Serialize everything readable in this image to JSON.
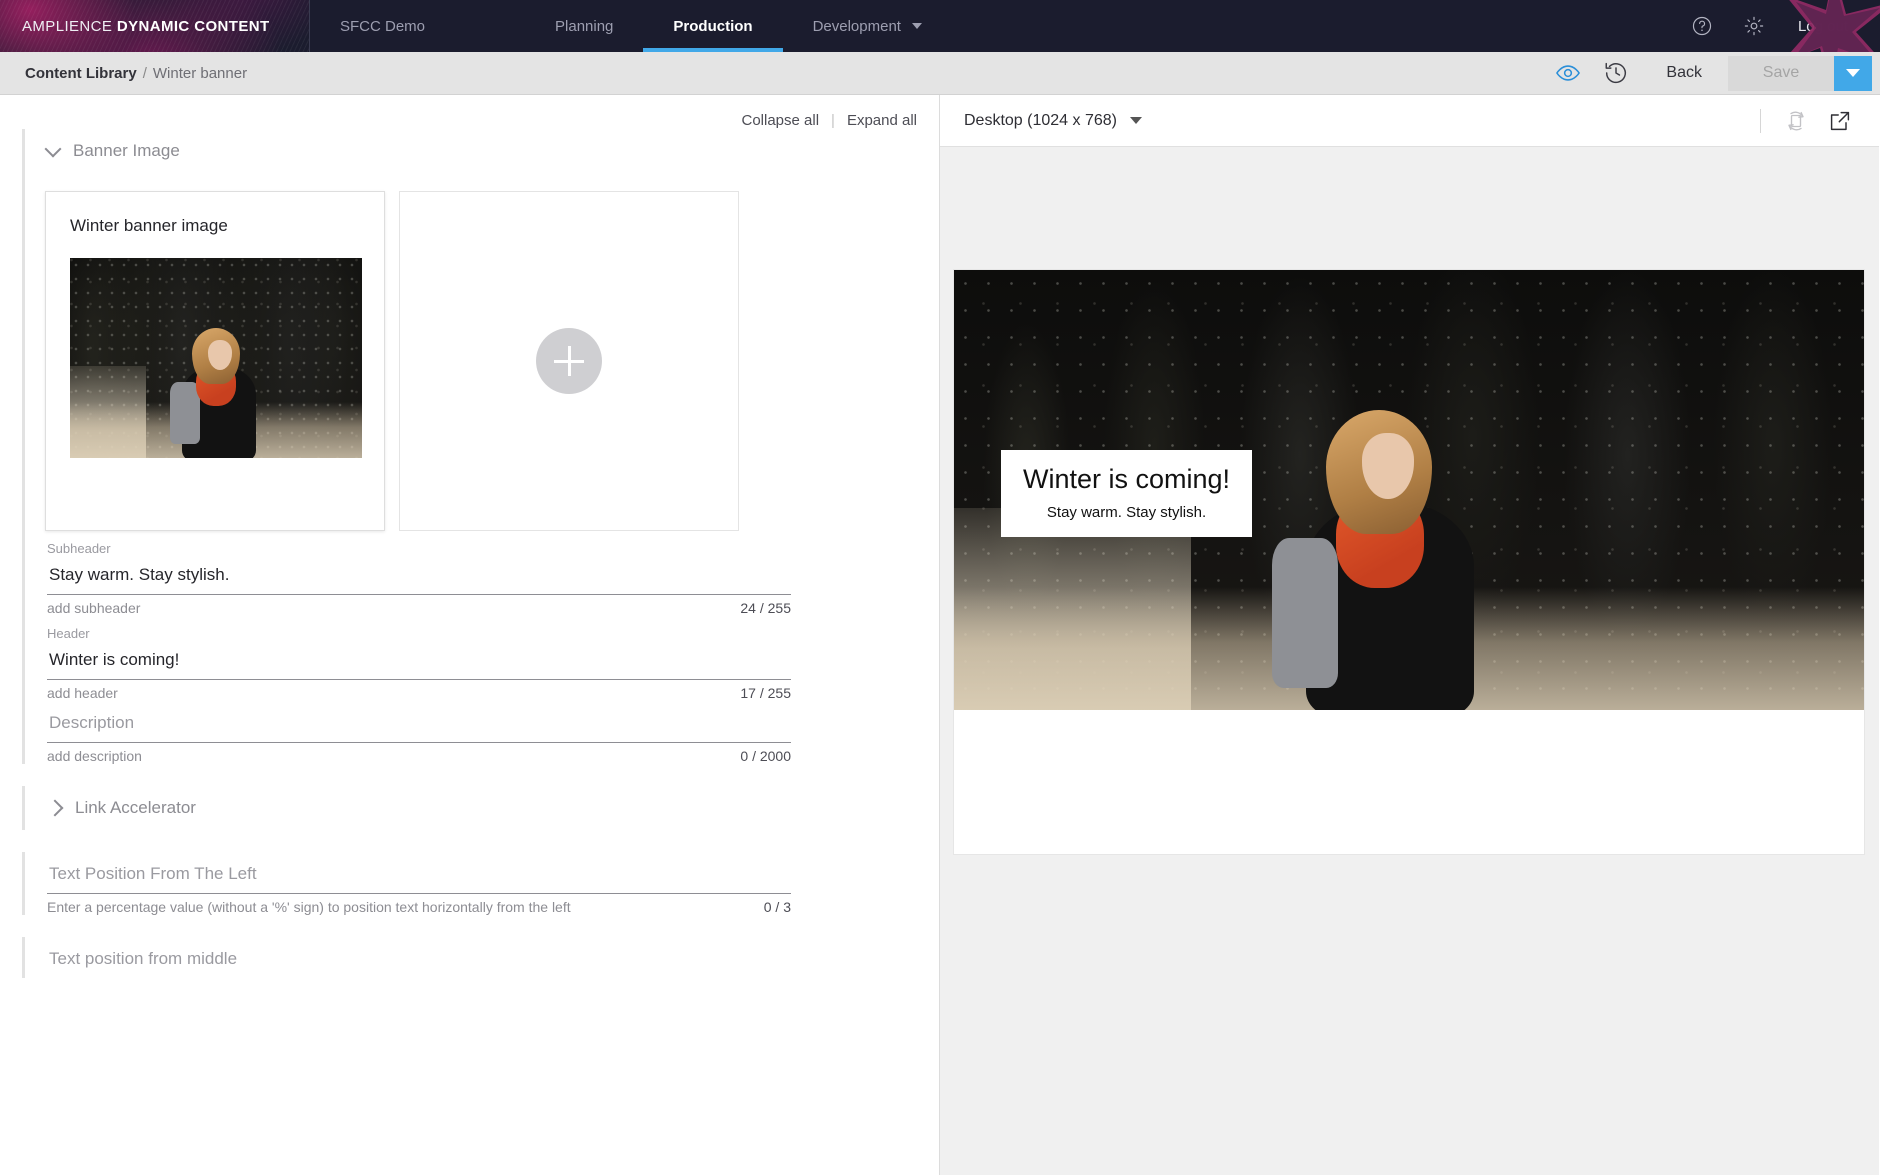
{
  "topnav": {
    "brand_light": "AMPLIENCE ",
    "brand_bold": "DYNAMIC CONTENT",
    "tenant": "SFCC Demo",
    "items": [
      {
        "label": "Planning",
        "active": false
      },
      {
        "label": "Production",
        "active": true
      },
      {
        "label": "Development",
        "active": false
      }
    ],
    "help_icon": "help-circle-icon",
    "settings_icon": "gear-icon",
    "logout": "Log out",
    "accent_active": "#41a8e8",
    "bar_bg": "#1b1c2e"
  },
  "subbar": {
    "breadcrumb_root": "Content Library",
    "breadcrumb_sep": "/",
    "breadcrumb_current": "Winter banner",
    "preview_icon": "eye-icon",
    "history_icon": "history-clock-icon",
    "back_label": "Back",
    "save_label": "Save",
    "save_dropdown_icon": "chevron-down-icon",
    "save_accent": "#41a8e8"
  },
  "editor": {
    "collapse_all": "Collapse all",
    "divider": "|",
    "expand_all": "Expand all",
    "sections": [
      {
        "title": "Banner Image",
        "expanded": true
      },
      {
        "title": "Link Accelerator",
        "expanded": false
      }
    ],
    "media_card": {
      "title": "Winter banner image",
      "image_alt": "winter-banner-thumbnail"
    },
    "add_card": {
      "icon": "plus-icon"
    },
    "fields": [
      {
        "label": "Subheader",
        "value": "Stay warm. Stay stylish.",
        "hint": "add subheader",
        "counter": "24 / 255",
        "empty": false
      },
      {
        "label": "Header",
        "value": "Winter is coming!",
        "hint": "add header",
        "counter": "17 / 255",
        "empty": false
      },
      {
        "label": "Description",
        "value": "",
        "hint": "add description",
        "counter": "0 / 2000",
        "empty": true
      },
      {
        "label": "Text Position From The Left",
        "value": "",
        "hint": "Enter a percentage value (without a '%' sign) to position text horizontally from the left",
        "counter": "0 / 3",
        "empty": true
      },
      {
        "label": "Text position from middle",
        "value": "",
        "hint": "",
        "counter": "",
        "empty": true
      }
    ]
  },
  "preview": {
    "device_label": "Desktop (1024 x 768)",
    "device_caret_icon": "chevron-down-icon",
    "refresh_icon": "rotate-device-icon",
    "open_external_icon": "external-link-icon",
    "banner": {
      "header": "Winter is coming!",
      "subheader": "Stay warm. Stay stylish."
    }
  }
}
